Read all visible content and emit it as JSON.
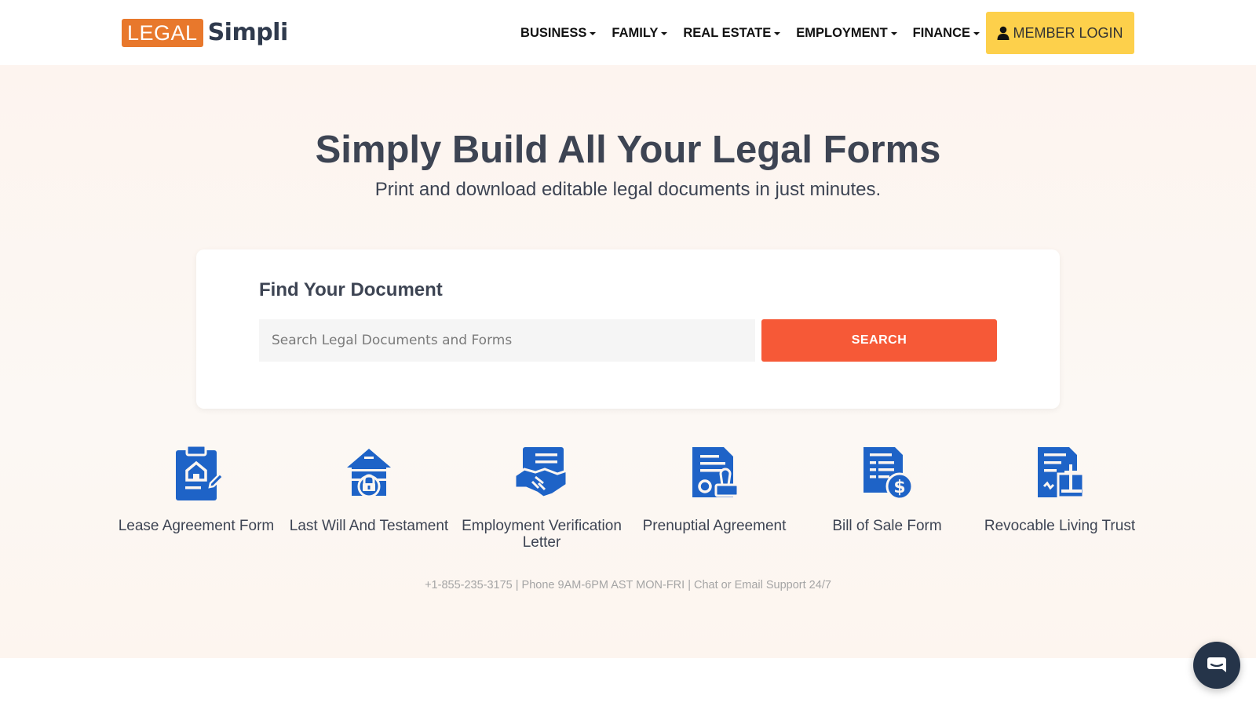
{
  "brand": {
    "logo_part1": "LEGAL",
    "logo_part2": "Simpli",
    "accent": "#e8782c"
  },
  "nav": {
    "items": [
      {
        "label": "BUSINESS"
      },
      {
        "label": "FAMILY"
      },
      {
        "label": "REAL ESTATE"
      },
      {
        "label": "EMPLOYMENT"
      },
      {
        "label": "FINANCE"
      }
    ],
    "login_label": "MEMBER LOGIN",
    "login_color": "#fdd04b"
  },
  "hero": {
    "title": "Simply Build All Your Legal Forms",
    "subtitle": "Print and download editable legal documents in just minutes."
  },
  "search": {
    "heading": "Find Your Document",
    "placeholder": "Search Legal Documents and Forms",
    "value": "",
    "button_label": "SEARCH",
    "button_color": "#f65937"
  },
  "documents": [
    {
      "label": "Lease Agreement Form",
      "icon": "lease-clipboard-icon"
    },
    {
      "label": "Last Will And Testament",
      "icon": "house-lock-icon"
    },
    {
      "label": "Employment Verification Letter",
      "icon": "handshake-document-icon"
    },
    {
      "label": "Prenuptial Agreement",
      "icon": "document-stamp-icon"
    },
    {
      "label": "Bill of Sale Form",
      "icon": "document-dollar-icon"
    },
    {
      "label": "Revocable Living Trust",
      "icon": "document-cross-icon"
    }
  ],
  "icon_color": "#1e63c7",
  "support_text": "+1-855-235-3175 | Phone 9AM-6PM AST MON-FRI | Chat or Email Support 24/7",
  "chat": {
    "icon": "chat-bubble-icon"
  }
}
